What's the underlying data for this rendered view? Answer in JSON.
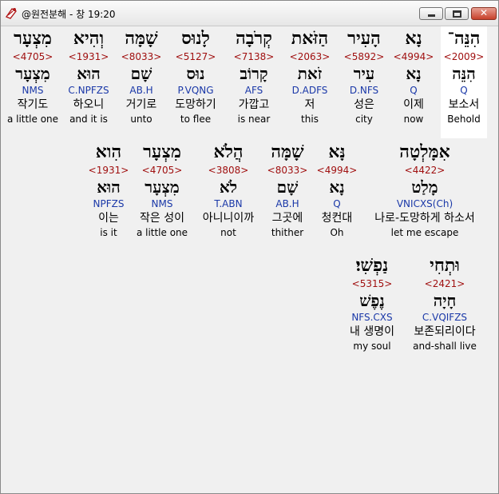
{
  "window": {
    "title": "@원전분해 - 창 19:20",
    "close_glyph": "✕"
  },
  "rows": [
    [
      {
        "hebrew": "הִנֵּה־",
        "strong": "<2009>",
        "lemma": "הִנֵּה",
        "morph": "Q",
        "korean": "보소서",
        "english": "Behold",
        "highlight": true
      },
      {
        "hebrew": "נָא",
        "strong": "<4994>",
        "lemma": "נָא",
        "morph": "Q",
        "korean": "이제",
        "english": "now"
      },
      {
        "hebrew": "הָעִיר",
        "strong": "<5892>",
        "lemma": "עִיר",
        "morph": "D.NFS",
        "korean": "성은",
        "english": "city"
      },
      {
        "hebrew": "הַזֹּאת",
        "strong": "<2063>",
        "lemma": "זֹאת",
        "morph": "D.ADFS",
        "korean": "저",
        "english": "this"
      },
      {
        "hebrew": "קְרֹבָה",
        "strong": "<7138>",
        "lemma": "קָרוֹב",
        "morph": "AFS",
        "korean": "가깝고",
        "english": "is near"
      },
      {
        "hebrew": "לָנוּס",
        "strong": "<5127>",
        "lemma": "נוּס",
        "morph": "P.VQNG",
        "korean": "도망하기",
        "english": "to flee"
      },
      {
        "hebrew": "שָׁמָּה",
        "strong": "<8033>",
        "lemma": "שָׁם",
        "morph": "AB.H",
        "korean": "거기로",
        "english": "unto"
      },
      {
        "hebrew": "וְהִיא",
        "strong": "<1931>",
        "lemma": "הוּא",
        "morph": "C.NPFZS",
        "korean": "하오니",
        "english": "and it is"
      },
      {
        "hebrew": "מִצְעָר",
        "strong": "<4705>",
        "lemma": "מִצְעָר",
        "morph": "NMS",
        "korean": "작기도",
        "english": "a little one"
      }
    ],
    [
      {
        "hebrew": "אִמָּלְטָה",
        "strong": "<4422>",
        "lemma": "מָלַט",
        "morph": "VNICXS(Ch)",
        "korean": "나로-도망하게 하소서",
        "english": "let me escape"
      },
      {
        "hebrew": "נָּא",
        "strong": "<4994>",
        "lemma": "נָא",
        "morph": "Q",
        "korean": "청컨대",
        "english": "Oh"
      },
      {
        "hebrew": "שָׁמָּה",
        "strong": "<8033>",
        "lemma": "שָׁם",
        "morph": "AB.H",
        "korean": "그곳에",
        "english": "thither"
      },
      {
        "hebrew": "הֲלֹא",
        "strong": "<3808>",
        "lemma": "לֹא",
        "morph": "T.ABN",
        "korean": "아니니이까",
        "english": "not"
      },
      {
        "hebrew": "מִצְעָר",
        "strong": "<4705>",
        "lemma": "מִצְעָר",
        "morph": "NMS",
        "korean": "작은 성이",
        "english": "a little one"
      },
      {
        "hebrew": "הִוא",
        "strong": "<1931>",
        "lemma": "הוּא",
        "morph": "NPFZS",
        "korean": "이는",
        "english": "is it"
      }
    ],
    [
      {
        "hebrew": "וּתְחִי",
        "strong": "<2421>",
        "lemma": "חָיָה",
        "morph": "C.VQIFZS",
        "korean": "보존되리이다",
        "english": "and-shall live"
      },
      {
        "hebrew": "נַפְשִׁי׃",
        "strong": "<5315>",
        "lemma": "נֶפֶשׁ",
        "morph": "NFS.CXS",
        "korean": "내 생명이",
        "english": "my soul"
      }
    ]
  ]
}
